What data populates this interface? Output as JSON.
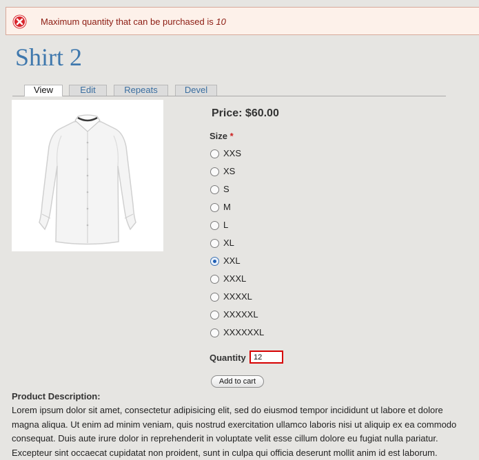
{
  "error": {
    "message": "Maximum quantity that can be purchased is",
    "limit": "10"
  },
  "product": {
    "title": "Shirt 2",
    "price": "Price: $60.00",
    "size_label": "Size",
    "required_marker": "*",
    "quantity_label": "Quantity",
    "quantity_value": "12",
    "add_to_cart": "Add to cart",
    "description_heading": "Product Description:",
    "description": "Lorem ipsum dolor sit amet, consectetur adipisicing elit, sed do eiusmod tempor incididunt ut labore et dolore magna aliqua. Ut enim ad minim veniam, quis nostrud exercitation ullamco laboris nisi ut aliquip ex ea commodo consequat. Duis aute irure dolor in reprehenderit in voluptate velit esse cillum dolore eu fugiat nulla pariatur. Excepteur sint occaecat cupidatat non proident, sunt in culpa qui officia deserunt mollit anim id est laborum."
  },
  "tabs": [
    {
      "label": "View",
      "active": true
    },
    {
      "label": "Edit",
      "active": false
    },
    {
      "label": "Repeats",
      "active": false
    },
    {
      "label": "Devel",
      "active": false
    }
  ],
  "sizes": [
    {
      "label": "XXS",
      "checked": false
    },
    {
      "label": "XS",
      "checked": false
    },
    {
      "label": "S",
      "checked": false
    },
    {
      "label": "M",
      "checked": false
    },
    {
      "label": "L",
      "checked": false
    },
    {
      "label": "XL",
      "checked": false
    },
    {
      "label": "XXL",
      "checked": true
    },
    {
      "label": "XXXL",
      "checked": false
    },
    {
      "label": "XXXXL",
      "checked": false
    },
    {
      "label": "XXXXXL",
      "checked": false
    },
    {
      "label": "XXXXXXL",
      "checked": false
    }
  ],
  "colors": {
    "error_text": "#8b1a10",
    "error_icon": "#d9262c",
    "title": "#3f78ad",
    "tab_link": "#3a6ea0",
    "invalid_border": "#d60000"
  },
  "icons": {
    "error": "error-x-icon"
  }
}
